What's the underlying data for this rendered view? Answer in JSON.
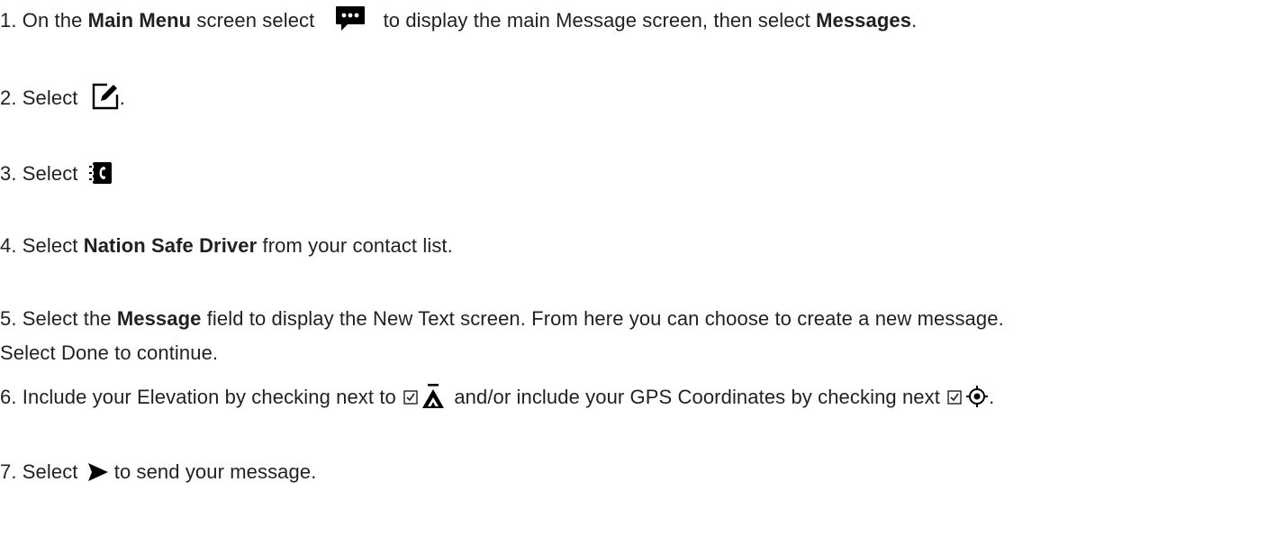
{
  "steps": {
    "s1": {
      "num": "1.",
      "a": " On the ",
      "b_main_menu": "Main Menu",
      "c": " screen select",
      "d": "to display the main Message screen, then select ",
      "b_messages": "Messages",
      "e": "."
    },
    "s2": {
      "num": "2.",
      "a": " Select",
      "b": "."
    },
    "s3": {
      "num": "3.",
      "a": " Select"
    },
    "s4": {
      "num": "4.",
      "a": " Select ",
      "b_contact": "Nation Safe Driver",
      "c": " from your contact list."
    },
    "s5": {
      "num": "5.",
      "a": " Select the ",
      "b_field": "Message",
      "c": " field to display the New Text screen. From here you can choose to create a new message.",
      "d": "Select Done to continue."
    },
    "s6": {
      "num": "6.",
      "a": " Include your Elevation by checking next to ",
      "b": " and/or include your GPS Coordinates by checking next ",
      "c": "."
    },
    "s7": {
      "num": "7.",
      "a": " Select ",
      "b": "to send your message."
    }
  },
  "icons": {
    "message": "speech-bubble-ellipsis-icon",
    "compose": "compose-pencil-icon",
    "contacts": "contact-book-phone-icon",
    "checkbox": "checked-box-icon",
    "elevation": "elevation-mountain-icon",
    "gps": "gps-crosshair-icon",
    "send": "send-arrow-icon"
  },
  "colors": {
    "text": "#231f20",
    "icon": "#000000"
  }
}
